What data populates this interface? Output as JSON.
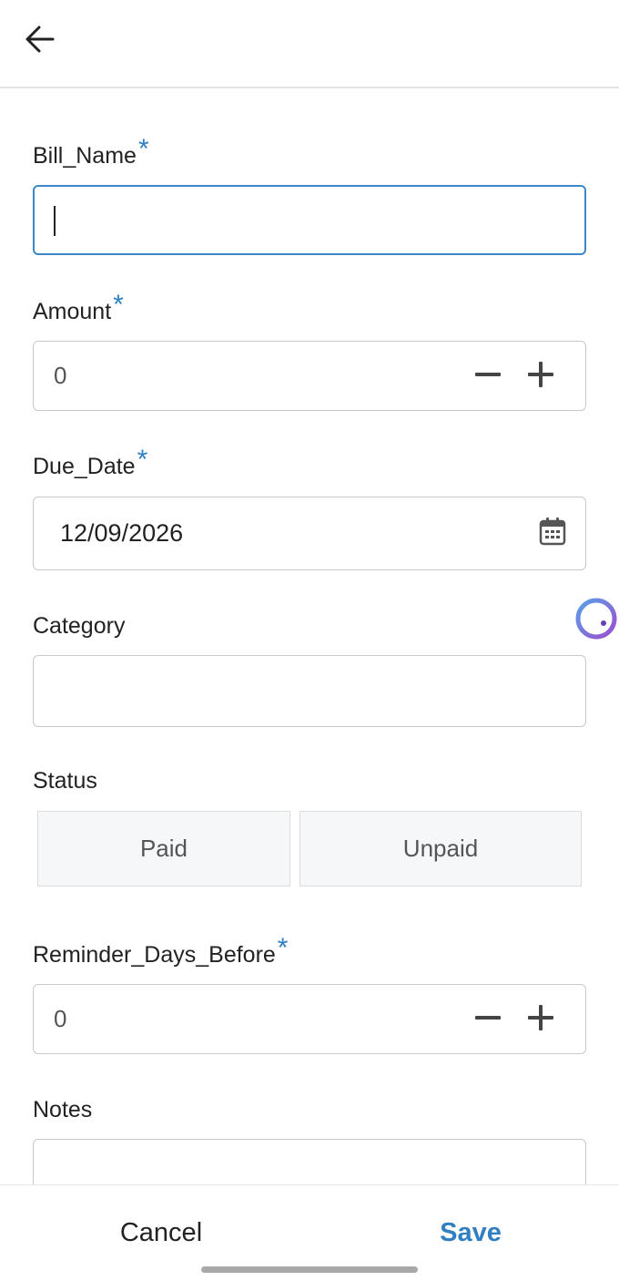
{
  "header": {
    "back_icon": "arrow-left-icon"
  },
  "form": {
    "bill_name": {
      "label": "Bill_Name",
      "required_mark": "*",
      "value": ""
    },
    "amount": {
      "label": "Amount",
      "required_mark": "*",
      "value": "0",
      "decrement_icon": "minus-icon",
      "increment_icon": "plus-icon"
    },
    "due_date": {
      "label": "Due_Date",
      "required_mark": "*",
      "value": "12/09/2026",
      "picker_icon": "calendar-icon"
    },
    "category": {
      "label": "Category",
      "value": ""
    },
    "status": {
      "label": "Status",
      "options": [
        "Paid",
        "Unpaid"
      ]
    },
    "reminder_days_before": {
      "label": "Reminder_Days_Before",
      "required_mark": "*",
      "value": "0",
      "decrement_icon": "minus-icon",
      "increment_icon": "plus-icon"
    },
    "notes": {
      "label": "Notes",
      "value": ""
    }
  },
  "footer": {
    "cancel_label": "Cancel",
    "save_label": "Save"
  },
  "colors": {
    "accent": "#2f7fc1",
    "focus_border": "#3d86c6",
    "field_border": "#c9c9c9",
    "status_bg": "#f6f7f9"
  }
}
